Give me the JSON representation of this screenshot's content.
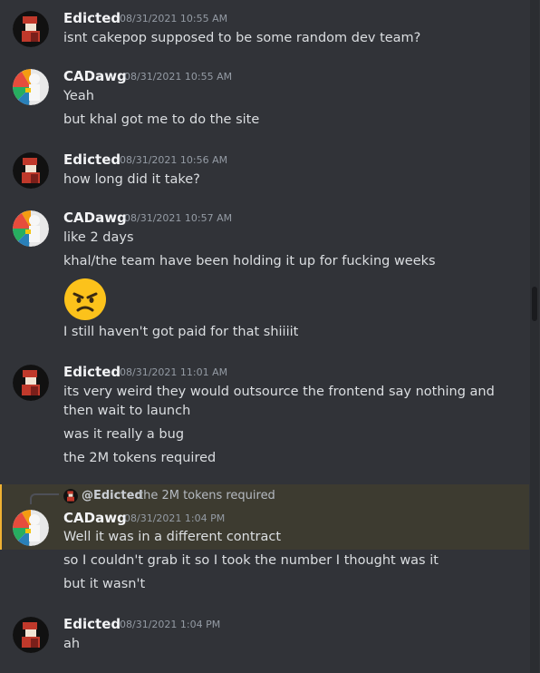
{
  "messages": [
    {
      "author": "Edicted",
      "timestamp": "08/31/2021 10:55 AM",
      "lines": [
        "isnt cakepop supposed to be some random dev team?"
      ]
    },
    {
      "author": "CADawg",
      "timestamp": "08/31/2021 10:55 AM",
      "lines": [
        "Yeah",
        "but khal got me to do the site"
      ]
    },
    {
      "author": "Edicted",
      "timestamp": "08/31/2021 10:56 AM",
      "lines": [
        "how long did it take?"
      ]
    },
    {
      "author": "CADawg",
      "timestamp": "08/31/2021 10:57 AM",
      "lines": [
        "like 2 days",
        "khal/the team have been holding it up for fucking weeks",
        "I still haven't got paid for that shiiiit"
      ],
      "emoji": "angry-face-emoji"
    },
    {
      "author": "Edicted",
      "timestamp": "08/31/2021 11:01 AM",
      "lines": [
        "its very weird they would outsource the frontend say nothing and",
        "then wait to launch",
        "was it really a bug",
        "the 2M tokens required"
      ]
    },
    {
      "author": "CADawg",
      "timestamp": "08/31/2021 1:04 PM",
      "reply": {
        "mention": "@Edicted",
        "text": "the 2M tokens required"
      },
      "lines": [
        "Well it was in a different contract",
        "so I couldn't grab it so I took the number I thought was it",
        "but it wasn't"
      ]
    },
    {
      "author": "Edicted",
      "timestamp": "08/31/2021 1:04 PM",
      "lines": [
        "ah"
      ]
    }
  ],
  "colors": {
    "background": "#313338",
    "mention_highlight": "#3d3b30",
    "highlight_bar": "#f0b232",
    "text": "#dbdee1",
    "timestamp": "#949ba4"
  }
}
